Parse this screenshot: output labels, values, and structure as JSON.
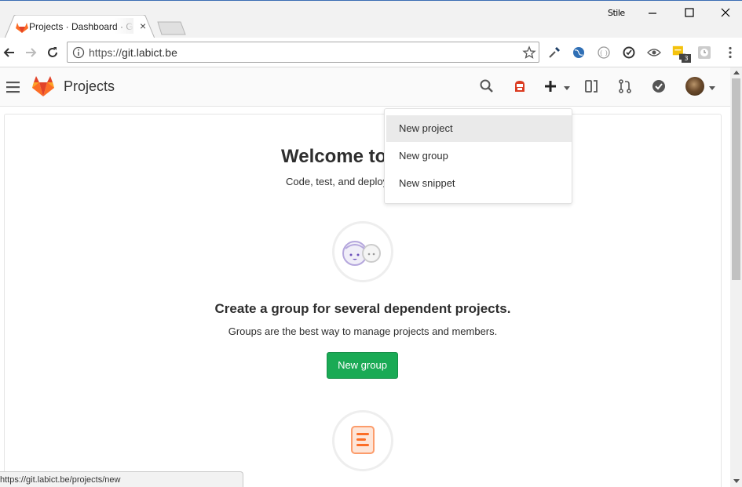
{
  "browser": {
    "tab_title": "Projects · Dashboard · GitLab",
    "tab_close": "×",
    "profile_label": "Stile",
    "url_scheme": "https://",
    "url_host": "git.labict.be",
    "extension_badge": "3",
    "status_url": "https://git.labict.be/projects/new"
  },
  "header": {
    "title": "Projects"
  },
  "new_menu": {
    "items": [
      {
        "label": "New project",
        "active": true
      },
      {
        "label": "New group",
        "active": false
      },
      {
        "label": "New snippet",
        "active": false
      }
    ]
  },
  "main": {
    "welcome_title": "Welcome to GitLab",
    "welcome_subtitle": "Code, test, and deploy together",
    "group_title": "Create a group for several dependent projects.",
    "group_description": "Groups are the best way to manage projects and members.",
    "new_group_button": "New group"
  },
  "colors": {
    "accent_green": "#1aaa55",
    "gitlab_orange": "#fc6d26",
    "gitlab_red": "#e24329"
  },
  "icons": [
    "search-icon",
    "issues-icon",
    "plus-icon",
    "todos-icon",
    "merge-request-icon",
    "check-icon",
    "hamburger-icon",
    "gitlab-logo"
  ]
}
